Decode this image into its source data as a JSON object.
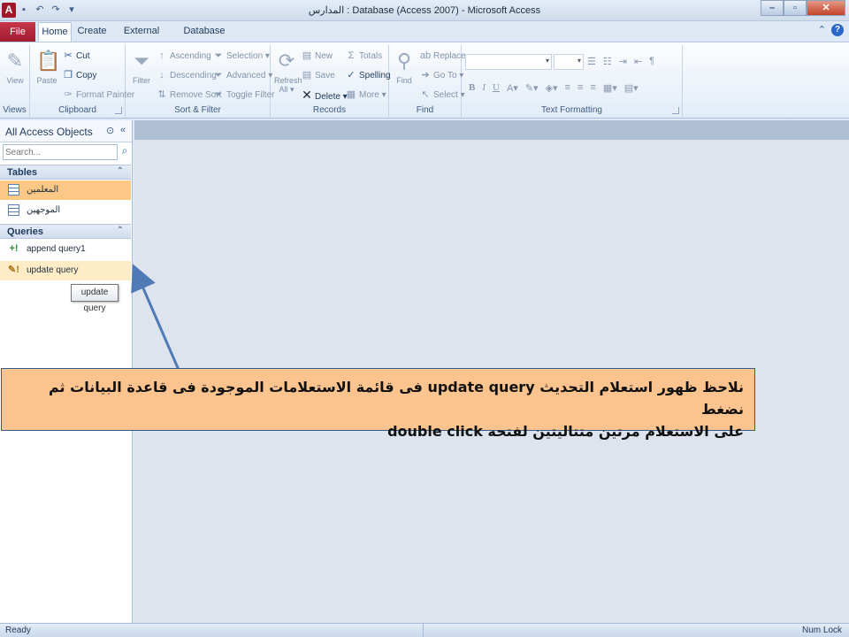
{
  "window": {
    "app_icon": "A",
    "title": "المدارس : Database (Access 2007)  -  Microsoft Access"
  },
  "tabs": {
    "file": "File",
    "items": [
      "Home",
      "Create",
      "External Data",
      "Database Tools"
    ]
  },
  "ribbon": {
    "views": {
      "view": "View",
      "label": "Views"
    },
    "clipboard": {
      "paste": "Paste",
      "cut": "Cut",
      "copy": "Copy",
      "format_painter": "Format Painter",
      "label": "Clipboard"
    },
    "sort_filter": {
      "filter": "Filter",
      "ascending": "Ascending",
      "descending": "Descending",
      "remove_sort": "Remove Sort",
      "selection": "Selection",
      "advanced": "Advanced",
      "toggle_filter": "Toggle Filter",
      "label": "Sort & Filter"
    },
    "records": {
      "refresh": "Refresh",
      "refresh_sub": "All",
      "new": "New",
      "save": "Save",
      "delete": "Delete",
      "totals": "Totals",
      "spelling": "Spelling",
      "more": "More",
      "label": "Records"
    },
    "find": {
      "find": "Find",
      "replace": "Replace",
      "goto": "Go To",
      "select": "Select",
      "label": "Find"
    },
    "text_formatting": {
      "bold": "B",
      "italic": "I",
      "underline": "U",
      "label": "Text Formatting"
    }
  },
  "nav": {
    "title": "All Access Objects",
    "search_placeholder": "Search...",
    "sections": [
      {
        "label": "Tables",
        "items": [
          "المعلمين",
          "الموجهين"
        ]
      },
      {
        "label": "Queries",
        "items": [
          "append query1",
          "update query"
        ]
      }
    ],
    "tooltip": "update query"
  },
  "statusbar": {
    "left": "Ready",
    "right": "Num Lock"
  },
  "annotation": {
    "line1": "نلاحظ ظهور استعلام  التحديث update query فى قائمة الاستعلامات الموجودة فى قاعدة البيانات ثم نضغط",
    "line2": "على الاستعلام مرتين متتاليتين لفتحه double click"
  },
  "colors": {
    "file_tab": "#b1233a",
    "selected_item": "#fbc985",
    "annotation_fill": "#fbc38d",
    "arrow": "#4f7ab5"
  }
}
